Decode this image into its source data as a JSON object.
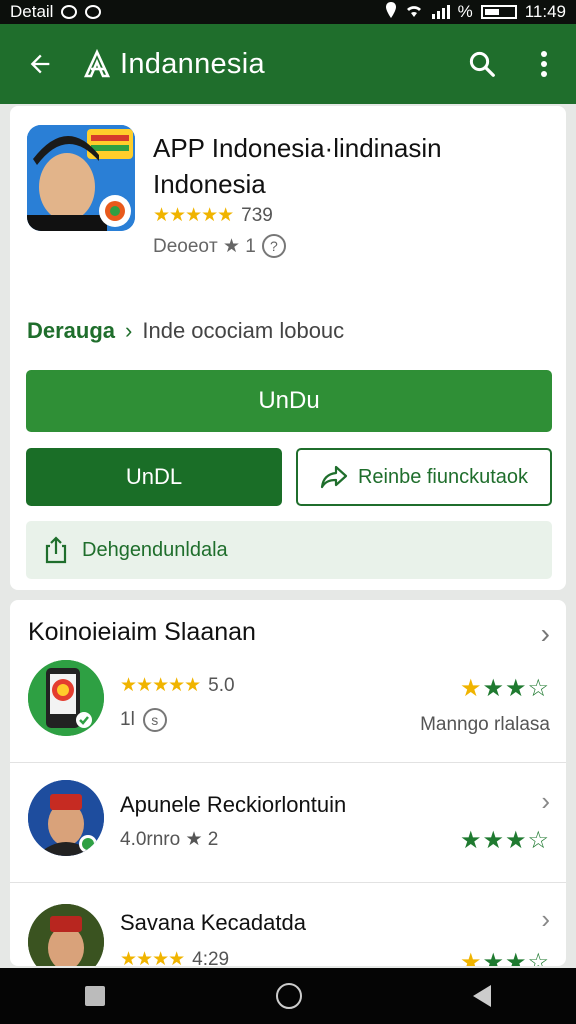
{
  "status_bar": {
    "left_text": "Detail",
    "percent": "%",
    "time": "11:49"
  },
  "app_bar": {
    "title": "Indannesia",
    "back_icon": "arrow-left-icon",
    "search_icon": "search-icon",
    "more_icon": "more-vert-icon"
  },
  "app": {
    "name": "APP Indonesia·lindinasin Indonesia",
    "stars": "★★★★★",
    "rating_count": "739",
    "meta": "Deoeoт ★ 1",
    "developer_link": "Derauga",
    "developer_sub": "Inde ocociam lobouc"
  },
  "buttons": {
    "install": "UnDu",
    "undl": "UnDL",
    "refund": "Reinbe fiunckutaok",
    "share": "Dehgendunldala"
  },
  "section": {
    "title": "Koinoieiaim Slaanan",
    "items": [
      {
        "name": "",
        "stars": "★★★★★",
        "rating": "5.0",
        "meta": "1l",
        "right_text": "Manngo rlalasa"
      },
      {
        "name": "Apunele Reckiorlontuin",
        "meta": "4.0rnro ★ 2"
      },
      {
        "name": "Savana Kecadatda",
        "stars": "★★★★",
        "meta": "4:29"
      }
    ]
  },
  "colors": {
    "primary": "#1f6e2c",
    "accent": "#2f8f36",
    "star": "#f0b400"
  }
}
